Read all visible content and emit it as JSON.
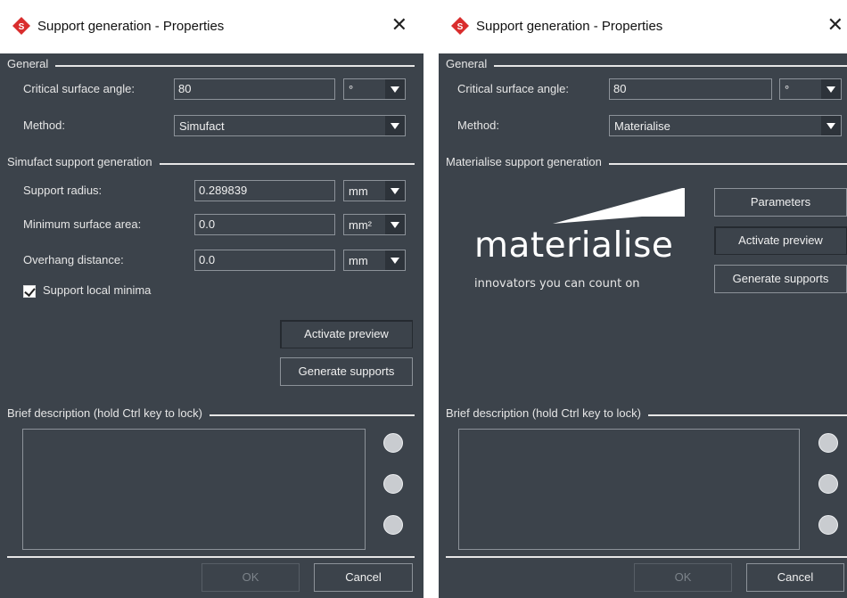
{
  "windows": [
    {
      "title": "Support generation - Properties",
      "general_label": "General",
      "critical_angle_label": "Critical surface angle:",
      "critical_angle_value": "80",
      "angle_unit": "°",
      "method_label": "Method:",
      "method_value": "Simufact",
      "section_label": "Simufact support generation",
      "support_radius_label": "Support radius:",
      "support_radius_value": "0.289839",
      "support_radius_unit": "mm",
      "min_surface_label": "Minimum surface area:",
      "min_surface_value": "0.0",
      "min_surface_unit": "mm²",
      "overhang_label": "Overhang distance:",
      "overhang_value": "0.0",
      "overhang_unit": "mm",
      "support_minima_label": "Support local minima",
      "activate_preview": "Activate preview",
      "generate_supports": "Generate supports",
      "brief_label": "Brief description (hold Ctrl key to lock)",
      "ok": "OK",
      "cancel": "Cancel"
    },
    {
      "title": "Support generation - Properties",
      "general_label": "General",
      "critical_angle_label": "Critical surface angle:",
      "critical_angle_value": "80",
      "angle_unit": "°",
      "method_label": "Method:",
      "method_value": "Materialise",
      "section_label": "Materialise support generation",
      "logo_name": "materialise",
      "logo_tagline": "innovators you can count on",
      "parameters": "Parameters",
      "activate_preview": "Activate preview",
      "generate_supports": "Generate supports",
      "brief_label": "Brief description (hold Ctrl key to lock)",
      "ok": "OK",
      "cancel": "Cancel"
    }
  ],
  "icons": {
    "app": "simufact-logo-icon",
    "close": "close-icon",
    "lock": "lock-icon",
    "add": "add-icon",
    "play": "play-icon"
  },
  "colors": {
    "panel": "#3c434b",
    "brand_red": "#d92d2d"
  }
}
